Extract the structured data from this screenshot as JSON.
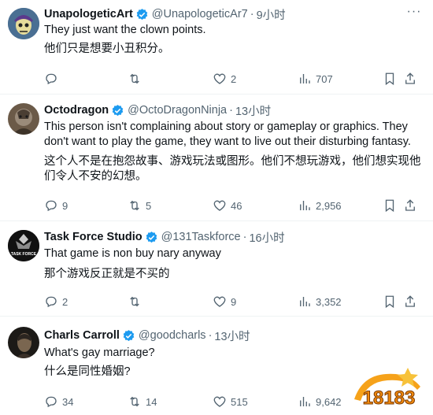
{
  "tweets": [
    {
      "name": "UnapologeticArt",
      "handle": "@UnapologeticAr7",
      "dot": "·",
      "time": "9小时",
      "text_en": "They just want the clown points.",
      "text_zh": "他们只是想要小丑积分。",
      "replies": "",
      "retweets": "",
      "likes": "2",
      "views": "707"
    },
    {
      "name": "Octodragon",
      "handle": "@OctoDragonNinja",
      "dot": "·",
      "time": "13小时",
      "text_en": "This person isn't complaining about story or gameplay or graphics. They don't want to play the game, they want to live out their disturbing fantasy.",
      "text_zh": "这个人不是在抱怨故事、游戏玩法或图形。他们不想玩游戏，他们想实现他们令人不安的幻想。",
      "replies": "9",
      "retweets": "5",
      "likes": "46",
      "views": "2,956"
    },
    {
      "name": "Task Force Studio",
      "handle": "@131Taskforce",
      "dot": "·",
      "time": "16小时",
      "text_en": "That game is non buy nary anyway",
      "text_zh": "那个游戏反正就是不买的",
      "replies": "2",
      "retweets": "",
      "likes": "9",
      "views": "3,352"
    },
    {
      "name": "Charls Carroll",
      "handle": "@goodcharls",
      "dot": "·",
      "time": "13小时",
      "text_en": "What's gay marriage?",
      "text_zh": "什么是同性婚姻?",
      "replies": "34",
      "retweets": "14",
      "likes": "515",
      "views": "9,642"
    }
  ],
  "avatar_labels": {
    "task_force": "TASK FORCE"
  },
  "watermark": {
    "text": "18183"
  },
  "colors": {
    "verified": "#1d9bf0",
    "muted": "#536471",
    "text": "#0f1419",
    "divider": "#eff3f4"
  },
  "icons": [
    "reply-icon",
    "retweet-icon",
    "like-icon",
    "views-icon",
    "bookmark-icon",
    "share-icon",
    "more-icon",
    "verified-icon"
  ]
}
